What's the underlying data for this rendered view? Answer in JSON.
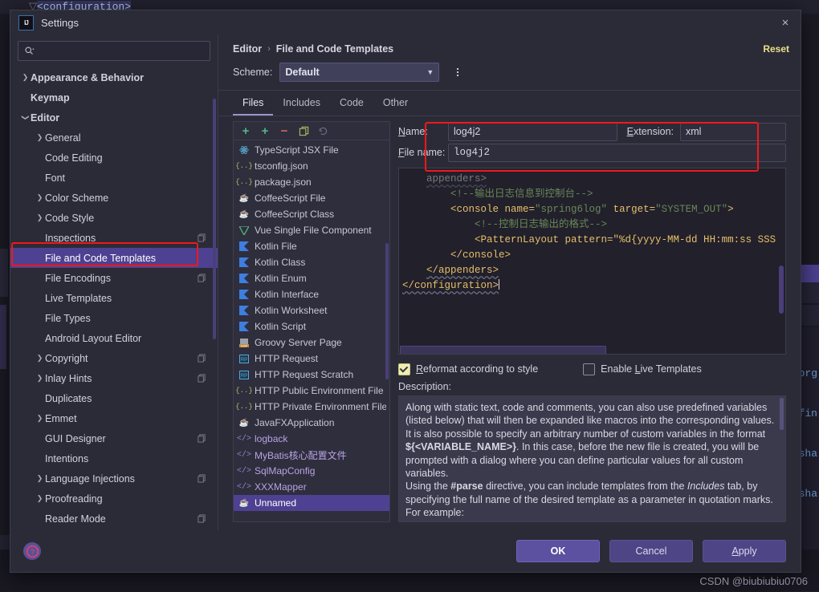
{
  "background": {
    "top_code_line": "<configuration>",
    "code_fragments": [
      "org",
      "efin",
      "sha",
      "sha"
    ]
  },
  "dialog": {
    "title": "Settings",
    "logo_text": "IJ",
    "close_label": "×"
  },
  "search": {
    "placeholder": "",
    "value": "",
    "icon": "search-icon"
  },
  "sidebar": {
    "items": [
      {
        "label": "Appearance & Behavior",
        "indent": 0,
        "arrow": "collapsed",
        "bold": true,
        "badge": false,
        "selected": false
      },
      {
        "label": "Keymap",
        "indent": 0,
        "arrow": "none",
        "bold": true,
        "badge": false,
        "selected": false
      },
      {
        "label": "Editor",
        "indent": 0,
        "arrow": "expanded",
        "bold": true,
        "badge": false,
        "selected": false
      },
      {
        "label": "General",
        "indent": 1,
        "arrow": "collapsed",
        "bold": false,
        "badge": false,
        "selected": false
      },
      {
        "label": "Code Editing",
        "indent": 1,
        "arrow": "none",
        "bold": false,
        "badge": false,
        "selected": false
      },
      {
        "label": "Font",
        "indent": 1,
        "arrow": "none",
        "bold": false,
        "badge": false,
        "selected": false
      },
      {
        "label": "Color Scheme",
        "indent": 1,
        "arrow": "collapsed",
        "bold": false,
        "badge": false,
        "selected": false
      },
      {
        "label": "Code Style",
        "indent": 1,
        "arrow": "collapsed",
        "bold": false,
        "badge": false,
        "selected": false
      },
      {
        "label": "Inspections",
        "indent": 1,
        "arrow": "none",
        "bold": false,
        "badge": true,
        "selected": false
      },
      {
        "label": "File and Code Templates",
        "indent": 1,
        "arrow": "none",
        "bold": false,
        "badge": false,
        "selected": true
      },
      {
        "label": "File Encodings",
        "indent": 1,
        "arrow": "none",
        "bold": false,
        "badge": true,
        "selected": false
      },
      {
        "label": "Live Templates",
        "indent": 1,
        "arrow": "none",
        "bold": false,
        "badge": false,
        "selected": false
      },
      {
        "label": "File Types",
        "indent": 1,
        "arrow": "none",
        "bold": false,
        "badge": false,
        "selected": false
      },
      {
        "label": "Android Layout Editor",
        "indent": 1,
        "arrow": "none",
        "bold": false,
        "badge": false,
        "selected": false
      },
      {
        "label": "Copyright",
        "indent": 1,
        "arrow": "collapsed",
        "bold": false,
        "badge": true,
        "selected": false
      },
      {
        "label": "Inlay Hints",
        "indent": 1,
        "arrow": "collapsed",
        "bold": false,
        "badge": true,
        "selected": false
      },
      {
        "label": "Duplicates",
        "indent": 1,
        "arrow": "none",
        "bold": false,
        "badge": false,
        "selected": false
      },
      {
        "label": "Emmet",
        "indent": 1,
        "arrow": "collapsed",
        "bold": false,
        "badge": false,
        "selected": false
      },
      {
        "label": "GUI Designer",
        "indent": 1,
        "arrow": "none",
        "bold": false,
        "badge": true,
        "selected": false
      },
      {
        "label": "Intentions",
        "indent": 1,
        "arrow": "none",
        "bold": false,
        "badge": false,
        "selected": false
      },
      {
        "label": "Language Injections",
        "indent": 1,
        "arrow": "collapsed",
        "bold": false,
        "badge": true,
        "selected": false
      },
      {
        "label": "Proofreading",
        "indent": 1,
        "arrow": "collapsed",
        "bold": false,
        "badge": false,
        "selected": false
      },
      {
        "label": "Reader Mode",
        "indent": 1,
        "arrow": "none",
        "bold": false,
        "badge": true,
        "selected": false
      }
    ]
  },
  "header": {
    "breadcrumb_root": "Editor",
    "breadcrumb_sep": "›",
    "breadcrumb_leaf": "File and Code Templates",
    "reset_label": "Reset",
    "scheme_label": "Scheme:",
    "scheme_value": "Default"
  },
  "tabs": [
    {
      "label": "Files",
      "active": true
    },
    {
      "label": "Includes",
      "active": false
    },
    {
      "label": "Code",
      "active": false
    },
    {
      "label": "Other",
      "active": false
    }
  ],
  "templates_toolbar": [
    {
      "name": "add-template-button",
      "glyph": "+",
      "color": "#4eb88a"
    },
    {
      "name": "add-child-button",
      "glyph": "+",
      "color": "#4eb88a"
    },
    {
      "name": "remove-template-button",
      "glyph": "−",
      "color": "#d0685f"
    },
    {
      "name": "copy-template-button",
      "glyph": "copy",
      "color": "#a5c261"
    },
    {
      "name": "reset-template-button",
      "glyph": "revert",
      "color": "#6b6a7c"
    }
  ],
  "templates": [
    {
      "label": "TypeScript JSX File",
      "icon": "react-icon",
      "icon_glyph": "⚛",
      "icon_color": "#5ab0d6",
      "selected": false
    },
    {
      "label": "tsconfig.json",
      "icon": "json-icon",
      "icon_glyph": "{..}",
      "icon_color": "#a5c261",
      "selected": false
    },
    {
      "label": "package.json",
      "icon": "json-icon",
      "icon_glyph": "{..}",
      "icon_color": "#a5c261",
      "selected": false
    },
    {
      "label": "CoffeeScript File",
      "icon": "coffee-icon",
      "icon_glyph": "☕",
      "icon_color": "#c98a5e",
      "selected": false
    },
    {
      "label": "CoffeeScript Class",
      "icon": "coffee-icon",
      "icon_glyph": "☕",
      "icon_color": "#c98a5e",
      "selected": false
    },
    {
      "label": "Vue Single File Component",
      "icon": "vue-icon",
      "icon_glyph": "V",
      "icon_color": "#52b57f",
      "selected": false
    },
    {
      "label": "Kotlin File",
      "icon": "kotlin-icon",
      "icon_glyph": "K",
      "icon_color": "#3c7fe0",
      "selected": false
    },
    {
      "label": "Kotlin Class",
      "icon": "kotlin-icon",
      "icon_glyph": "K",
      "icon_color": "#3c7fe0",
      "selected": false
    },
    {
      "label": "Kotlin Enum",
      "icon": "kotlin-icon",
      "icon_glyph": "K",
      "icon_color": "#3c7fe0",
      "selected": false
    },
    {
      "label": "Kotlin Interface",
      "icon": "kotlin-icon",
      "icon_glyph": "K",
      "icon_color": "#3c7fe0",
      "selected": false
    },
    {
      "label": "Kotlin Worksheet",
      "icon": "kotlin-icon",
      "icon_glyph": "K",
      "icon_color": "#3c7fe0",
      "selected": false
    },
    {
      "label": "Kotlin Script",
      "icon": "kotlin-icon",
      "icon_glyph": "K",
      "icon_color": "#3c7fe0",
      "selected": false
    },
    {
      "label": "Groovy Server Page",
      "icon": "gsp-icon",
      "icon_glyph": "G",
      "icon_color": "#c98a3e",
      "selected": false
    },
    {
      "label": "HTTP Request",
      "icon": "http-icon",
      "icon_glyph": "H",
      "icon_color": "#5aa5d6",
      "selected": false
    },
    {
      "label": "HTTP Request Scratch",
      "icon": "http-icon",
      "icon_glyph": "H",
      "icon_color": "#5aa5d6",
      "selected": false
    },
    {
      "label": "HTTP Public Environment File",
      "icon": "json-icon",
      "icon_glyph": "{..}",
      "icon_color": "#a5c261",
      "selected": false
    },
    {
      "label": "HTTP Private Environment File",
      "icon": "json-icon",
      "icon_glyph": "{..}",
      "icon_color": "#a5c261",
      "selected": false
    },
    {
      "label": "JavaFXApplication",
      "icon": "java-icon",
      "icon_glyph": "☕",
      "icon_color": "#9aa3ab",
      "selected": false
    },
    {
      "label": "logback",
      "icon": "xml-icon",
      "icon_glyph": "</>",
      "icon_color": "#9b7ad6",
      "selected": false
    },
    {
      "label": "MyBatis核心配置文件",
      "icon": "xml-icon",
      "icon_glyph": "</>",
      "icon_color": "#9b7ad6",
      "selected": false
    },
    {
      "label": "SqlMapConfig",
      "icon": "xml-icon",
      "icon_glyph": "</>",
      "icon_color": "#9b7ad6",
      "selected": false
    },
    {
      "label": "XXXMapper",
      "icon": "xml-icon",
      "icon_glyph": "</>",
      "icon_color": "#9b7ad6",
      "selected": false
    },
    {
      "label": "Unnamed",
      "icon": "java-icon",
      "icon_glyph": "☕",
      "icon_color": "#9aa3ab",
      "selected": true
    }
  ],
  "fields": {
    "name_label": "Name:",
    "name_value": "log4j2",
    "extension_label": "Extension:",
    "extension_value": "xml",
    "filename_label": "File name:",
    "filename_value": "log4j2"
  },
  "editor": {
    "lines": [
      {
        "indent": 4,
        "text": "appenders>",
        "type": "faded"
      },
      {
        "indent": 8,
        "text": "<!--输出日志信息到控制台-->",
        "type": "comment"
      },
      {
        "indent": 8,
        "text": "<console name=\"spring6log\" target=\"SYSTEM_OUT\">",
        "type": "tag"
      },
      {
        "indent": 12,
        "text": "<!--控制日志输出的格式-->",
        "type": "comment"
      },
      {
        "indent": 12,
        "text": "<PatternLayout pattern=\"%d{yyyy-MM-dd HH:mm:ss SSS",
        "type": "tag"
      },
      {
        "indent": 8,
        "text": "</console>",
        "type": "tag"
      },
      {
        "indent": 4,
        "text": "</appenders>",
        "type": "tag"
      },
      {
        "indent": 0,
        "text": "</configuration>",
        "type": "tag"
      }
    ]
  },
  "options": {
    "reformat_label": "Reformat according to style",
    "reformat_checked": true,
    "live_templates_label": "Enable Live Templates",
    "live_templates_checked": false
  },
  "description": {
    "label": "Description:",
    "paragraphs": [
      "Along with static text, code and comments, you can also use predefined variables (listed below) that will then be expanded like macros into the corresponding values.",
      "It is also possible to specify an arbitrary number of custom variables in the format ${<VARIABLE_NAME>}. In this case, before the new file is created, you will be prompted with a dialog where you can define particular values for all custom variables.",
      "Using the #parse directive, you can include templates from the Includes tab, by specifying the full name of the desired template as a parameter in quotation marks. For example:"
    ]
  },
  "footer": {
    "help_label": "?",
    "ok_label": "OK",
    "cancel_label": "Cancel",
    "apply_label": "Apply"
  },
  "watermark": "CSDN @biubiubiu0706",
  "colors": {
    "accent_purple": "#4e4191",
    "reset_yellow": "#e8e08a",
    "annotation_red": "#f21818",
    "checkbox_on": "#f0eeb0"
  }
}
